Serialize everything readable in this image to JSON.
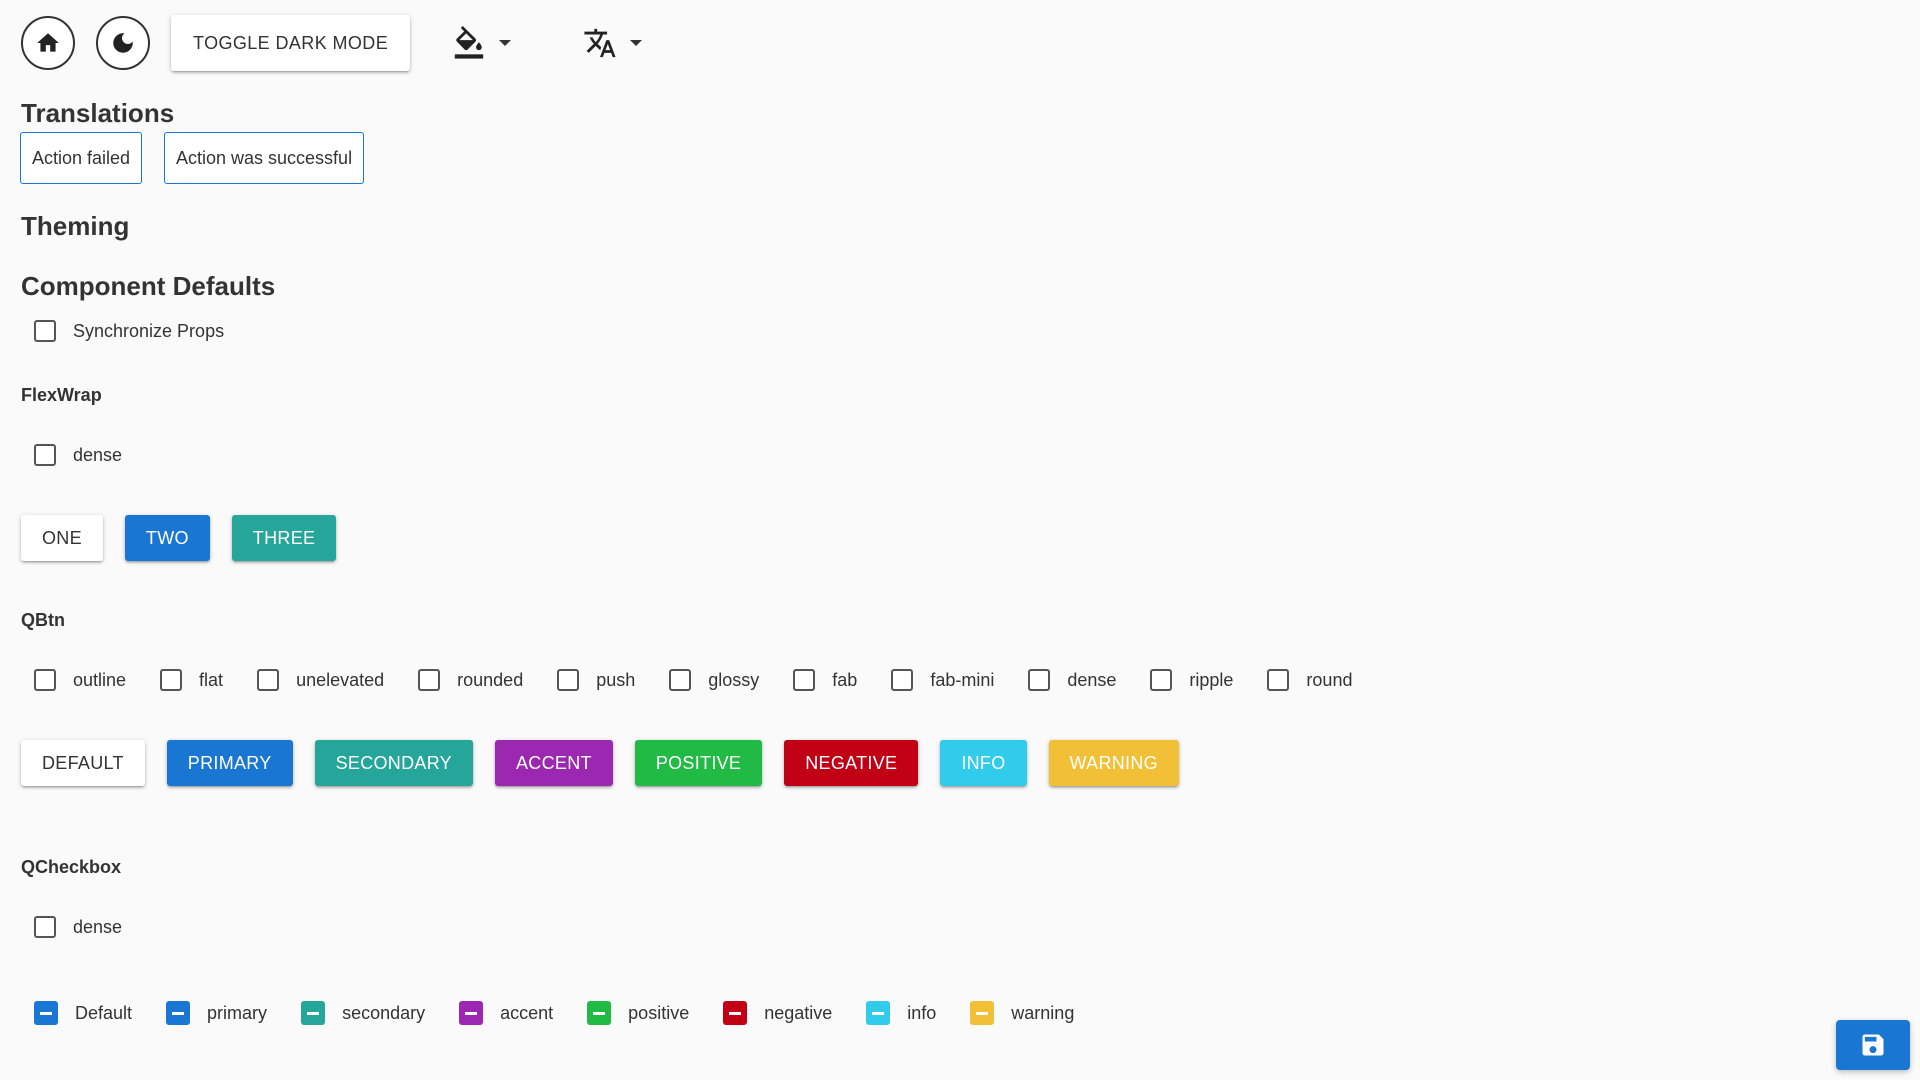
{
  "toolbar": {
    "home_icon": "home-icon",
    "dark_icon": "moon-icon",
    "toggle_label": "TOGGLE DARK MODE",
    "theme_icon": "paint-bucket-icon",
    "language_icon": "translate-icon"
  },
  "translations": {
    "heading": "Translations",
    "failed_label": "Action failed",
    "success_label": "Action was successful"
  },
  "theming": {
    "heading": "Theming"
  },
  "defaults": {
    "heading": "Component Defaults",
    "sync_label": "Synchronize Props"
  },
  "flexwrap": {
    "heading": "FlexWrap",
    "dense_label": "dense",
    "buttons": [
      "ONE",
      "TWO",
      "THREE"
    ]
  },
  "qbtn": {
    "heading": "QBtn",
    "options": [
      "outline",
      "flat",
      "unelevated",
      "rounded",
      "push",
      "glossy",
      "fab",
      "fab-mini",
      "dense",
      "ripple",
      "round"
    ],
    "buttons": [
      "DEFAULT",
      "PRIMARY",
      "SECONDARY",
      "ACCENT",
      "POSITIVE",
      "NEGATIVE",
      "INFO",
      "WARNING"
    ]
  },
  "qcheckbox": {
    "heading": "QCheckbox",
    "dense_label": "dense",
    "colors": [
      "Default",
      "primary",
      "secondary",
      "accent",
      "positive",
      "negative",
      "info",
      "warning"
    ]
  },
  "colors": {
    "primary": "#1976d2",
    "secondary": "#26a69a",
    "accent": "#9c27b0",
    "positive": "#21ba45",
    "negative": "#c10015",
    "info": "#31ccec",
    "warning": "#f2c037"
  },
  "save_icon": "save-icon"
}
